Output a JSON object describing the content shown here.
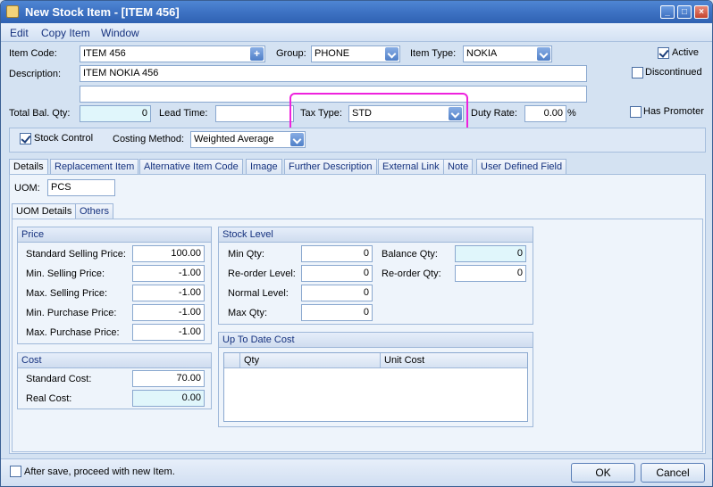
{
  "window": {
    "title": "New Stock Item - [ITEM 456]"
  },
  "menu": [
    "Edit",
    "Copy Item",
    "Window"
  ],
  "header": {
    "item_code_label": "Item Code:",
    "item_code": "ITEM 456",
    "group_label": "Group:",
    "group": "PHONE",
    "item_type_label": "Item Type:",
    "item_type": "NOKIA",
    "active_label": "Active",
    "discontinued_label": "Discontinued",
    "description_label": "Description:",
    "description": "ITEM NOKIA 456",
    "description2": "",
    "total_bal_label": "Total Bal. Qty:",
    "total_bal": "0",
    "lead_time_label": "Lead Time:",
    "lead_time": "",
    "tax_type_label": "Tax Type:",
    "tax_type": "STD",
    "duty_rate_label": "Duty Rate:",
    "duty_rate": "0.00",
    "duty_rate_unit": "%",
    "has_promoter_label": "Has Promoter",
    "stock_control_label": "Stock Control",
    "costing_method_label": "Costing Method:",
    "costing_method": "Weighted Average"
  },
  "tabs": [
    "Details",
    "Replacement Item",
    "Alternative Item Code",
    "Image",
    "Further Description",
    "External Link",
    "Note",
    "User Defined Field"
  ],
  "details": {
    "uom_label": "UOM:",
    "uom": "PCS",
    "subtabs": [
      "UOM Details",
      "Others"
    ],
    "price": {
      "title": "Price",
      "rows": [
        {
          "label": "Standard Selling Price:",
          "value": "100.00"
        },
        {
          "label": "Min. Selling Price:",
          "value": "-1.00"
        },
        {
          "label": "Max. Selling Price:",
          "value": "-1.00"
        },
        {
          "label": "Min. Purchase Price:",
          "value": "-1.00"
        },
        {
          "label": "Max. Purchase Price:",
          "value": "-1.00"
        }
      ]
    },
    "cost": {
      "title": "Cost",
      "standard_label": "Standard Cost:",
      "standard": "70.00",
      "real_label": "Real Cost:",
      "real": "0.00"
    },
    "stock_level": {
      "title": "Stock Level",
      "min_label": "Min Qty:",
      "min": "0",
      "reorder_label": "Re-order Level:",
      "reorder": "0",
      "normal_label": "Normal Level:",
      "normal": "0",
      "max_label": "Max Qty:",
      "max": "0",
      "balance_label": "Balance Qty:",
      "balance": "0",
      "reorder_qty_label": "Re-order Qty:",
      "reorder_qty": "0"
    },
    "up_to_date_cost": {
      "title": "Up To Date Cost",
      "columns": [
        "Qty",
        "Unit Cost"
      ]
    }
  },
  "footer": {
    "proceed_label": "After save, proceed with new Item.",
    "ok_label": "OK",
    "cancel_label": "Cancel"
  }
}
